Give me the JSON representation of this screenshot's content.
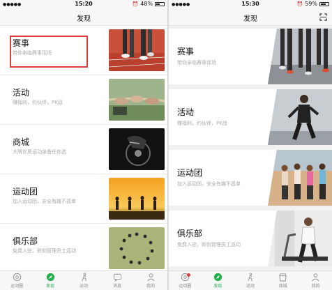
{
  "left": {
    "status": {
      "time": "15:20",
      "battery": "48%"
    },
    "nav_title": "发现",
    "items": [
      {
        "title": "赛事",
        "sub": "带你亲临赛事现场"
      },
      {
        "title": "活动",
        "sub": "赚福利，约伙伴，PK战"
      },
      {
        "title": "商城",
        "sub": "大牌优质运动装备任你选"
      },
      {
        "title": "运动团",
        "sub": "加入运动团，安全有趣不孤单"
      },
      {
        "title": "俱乐部",
        "sub": "免费入驻，即刻管理员工运动"
      }
    ],
    "tabs": [
      {
        "label": "运动圈",
        "icon": "circle-icon"
      },
      {
        "label": "发现",
        "icon": "compass-icon"
      },
      {
        "label": "运动",
        "icon": "run-icon"
      },
      {
        "label": "消息",
        "icon": "message-icon"
      },
      {
        "label": "我的",
        "icon": "person-icon"
      }
    ],
    "active_tab": "发现"
  },
  "right": {
    "status": {
      "time": "15:30",
      "battery": "59%"
    },
    "nav_title": "发现",
    "items": [
      {
        "title": "赛事",
        "sub": "带你亲临赛事现场"
      },
      {
        "title": "活动",
        "sub": "赚福利，约伙伴，PK战"
      },
      {
        "title": "运动团",
        "sub": "加入运动团，安全有趣不孤单"
      },
      {
        "title": "俱乐部",
        "sub": "免费入驻，即刻管理员工运动"
      }
    ],
    "tabs": [
      {
        "label": "运动圈",
        "icon": "circle-icon"
      },
      {
        "label": "发现",
        "icon": "compass-icon"
      },
      {
        "label": "运动",
        "icon": "run-icon"
      },
      {
        "label": "商城",
        "icon": "shop-icon"
      },
      {
        "label": "我的",
        "icon": "person-icon"
      }
    ],
    "active_tab": "发现"
  },
  "colors": {
    "accent": "#23b14d",
    "highlight": "#e23b3b",
    "badge": "#e23b3b"
  }
}
